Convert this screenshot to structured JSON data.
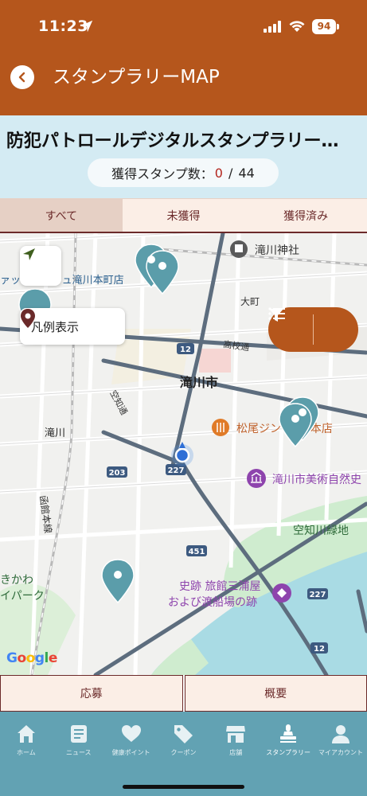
{
  "status_bar": {
    "time": "11:23",
    "battery": "94"
  },
  "header": {
    "title": "スタンプラリーMAP"
  },
  "rally": {
    "title": "防犯パトロールデジタルスタンプラリー…",
    "stamp_count_label": "獲得スタンプ数：",
    "stamp_count_acquired": "0",
    "stamp_count_sep": " / ",
    "stamp_count_total": "44"
  },
  "tabs": [
    {
      "label": "すべて",
      "active": true
    },
    {
      "label": "未獲得",
      "active": false
    },
    {
      "label": "獲得済み",
      "active": false
    }
  ],
  "map": {
    "legend_label": "凡例表示",
    "google_logo": "Google",
    "labels": {
      "shrine": "滝川神社",
      "omachi": "大町",
      "koko": "高校通",
      "city": "滝川市",
      "kusotsu": "空知通",
      "takikawa_station": "滝川",
      "restaurant": "松尾ジン カン 本店",
      "museum": "滝川市美術自然史",
      "kawa_ryokuchi": "空知川緑地",
      "hakodate_line": "函館本線",
      "kikawa": "きかわ",
      "ipark": "イパーク",
      "shiseki1": "史跡 旅館三浦屋",
      "shiseki2": "および渡船場の跡",
      "store_partial": "ァックスバリュ滝川本町店",
      "r12a": "12",
      "r12b": "12",
      "r227a": "227",
      "r227b": "227",
      "r203": "203",
      "r451": "451"
    }
  },
  "actions": {
    "apply": "応募",
    "overview": "概要"
  },
  "tabbar": [
    {
      "label": "ホーム",
      "icon": "home-icon"
    },
    {
      "label": "ニュース",
      "icon": "news-icon"
    },
    {
      "label": "健康ポイント",
      "icon": "heart-icon"
    },
    {
      "label": "クーポン",
      "icon": "tag-icon"
    },
    {
      "label": "店舗",
      "icon": "store-icon"
    },
    {
      "label": "スタンプラリー",
      "icon": "stamp-icon",
      "active": true
    },
    {
      "label": "マイアカウント",
      "icon": "person-icon"
    }
  ],
  "colors": {
    "brand": "#b5561c",
    "tabbar": "#62a2b3",
    "pin": "#5b9daa",
    "accent_text": "#6b2a2a"
  }
}
